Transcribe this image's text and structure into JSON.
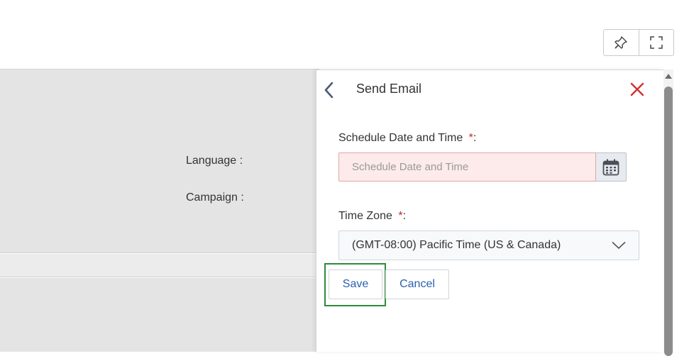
{
  "toolbar": {
    "pin_icon": "pin-icon",
    "expand_icon": "expand-icon"
  },
  "background_form": {
    "language_label": "Language :",
    "campaign_label": "Campaign :"
  },
  "panel": {
    "title": "Send Email",
    "back_icon": "chevron-left-icon",
    "close_icon": "close-icon",
    "schedule": {
      "label": "Schedule Date and Time",
      "required_mark": "*",
      "colon": ":",
      "value": "",
      "placeholder": "Schedule Date and Time",
      "calendar_icon": "calendar-icon"
    },
    "timezone": {
      "label": "Time Zone",
      "required_mark": "*",
      "colon": ":",
      "selected": "(GMT-08:00) Pacific Time (US & Canada)",
      "chevron_icon": "chevron-down-icon"
    },
    "save_label": "Save",
    "cancel_label": "Cancel"
  },
  "colors": {
    "accent_link": "#2a5fb0",
    "close_red": "#d32f2f",
    "required_red": "#c62828",
    "focus_green": "#2e8b3e",
    "invalid_bg": "#fdeaea"
  }
}
